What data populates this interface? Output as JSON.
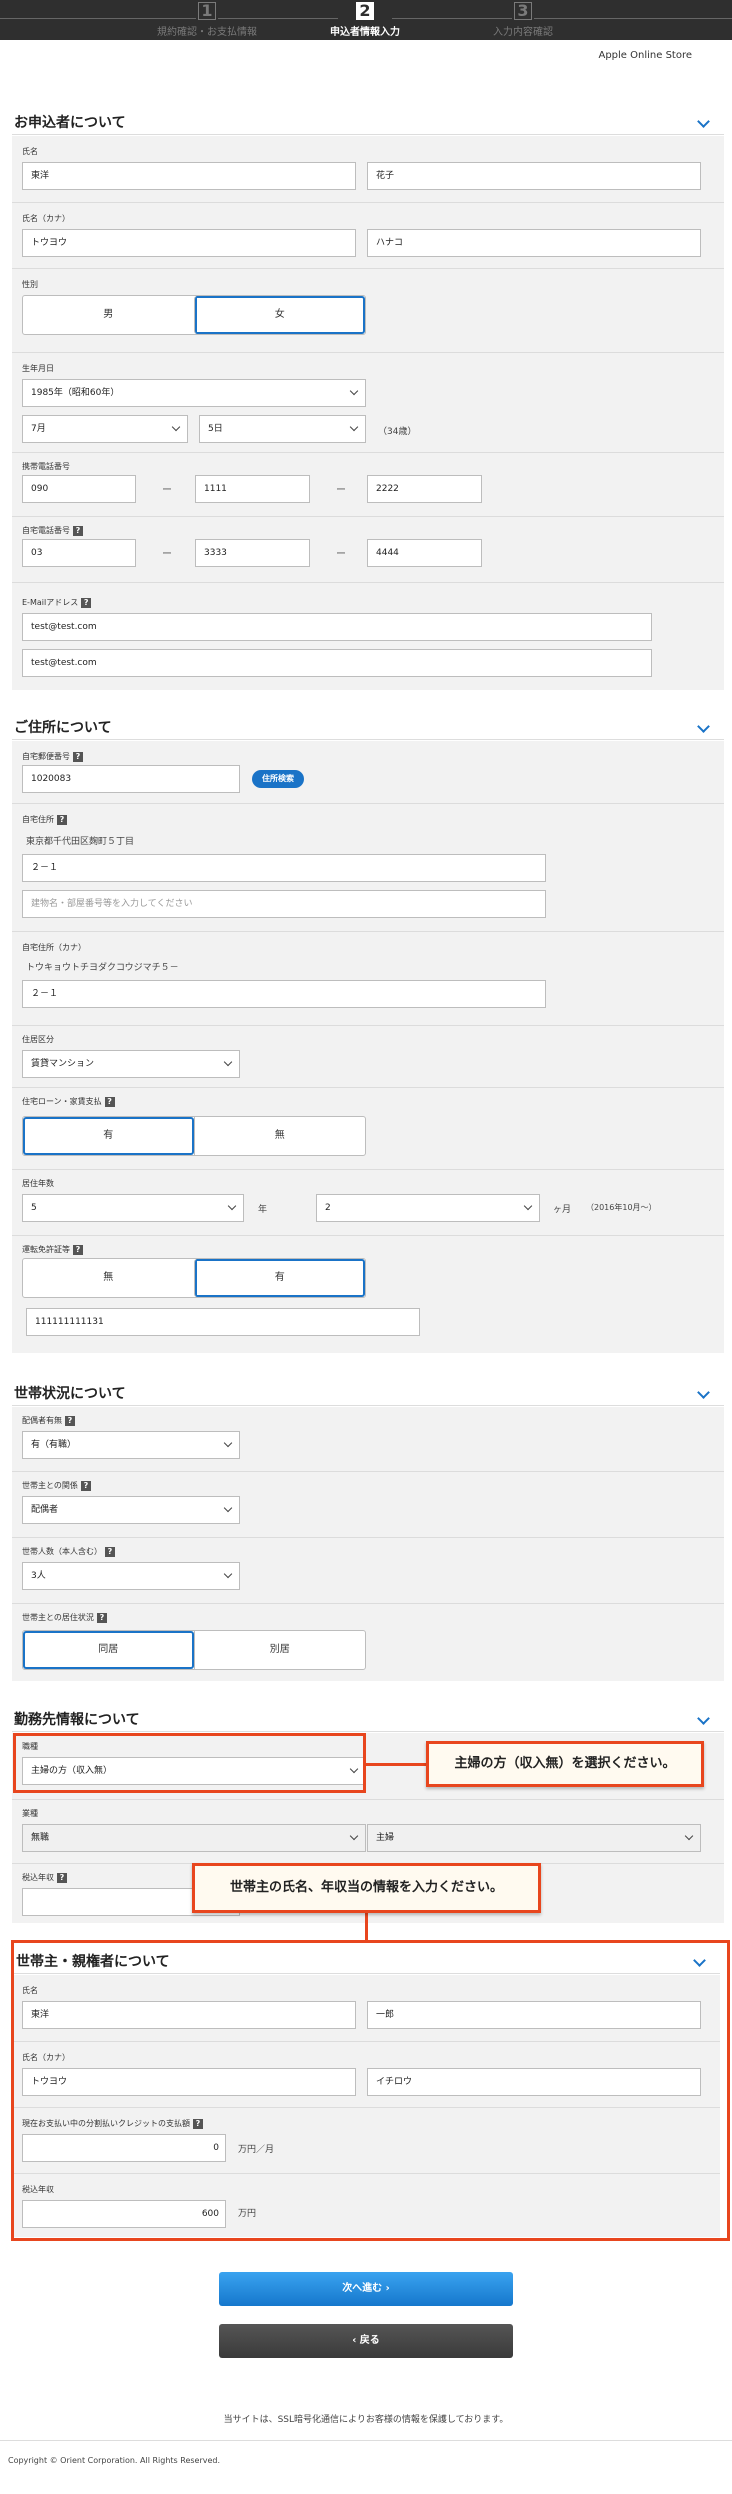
{
  "steps": [
    {
      "num": "1",
      "label": "規約確認・お支払情報"
    },
    {
      "num": "2",
      "label": "申込者情報入力"
    },
    {
      "num": "3",
      "label": "入力内容確認"
    }
  ],
  "store_name": "Apple Online Store",
  "applicant": {
    "title": "お申込者について",
    "name_label": "氏名",
    "last_name": "東洋",
    "first_name": "花子",
    "kana_label": "氏名（カナ）",
    "last_kana": "トウヨウ",
    "first_kana": "ハナコ",
    "gender_label": "性別",
    "gender_options": [
      "男",
      "女"
    ],
    "birth_label": "生年月日",
    "birth_year": "1985年（昭和60年）",
    "birth_month": "7月",
    "birth_day": "5日",
    "age_note": "（34歳）",
    "mobile_label": "携帯電話番号",
    "mobile": [
      "090",
      "1111",
      "2222"
    ],
    "home_phone_label": "自宅電話番号",
    "home_phone": [
      "03",
      "3333",
      "4444"
    ],
    "email_label": "E-Mailアドレス",
    "email": "test@test.com",
    "email_confirm": "test@test.com",
    "dash": "ー",
    "help": "?"
  },
  "address": {
    "title": "ご住所について",
    "zip_label": "自宅郵便番号",
    "zip": "1020083",
    "zip_search": "住所検索",
    "addr_label": "自宅住所",
    "addr_base": "東京都千代田区麹町５丁目",
    "addr_line": "２－１",
    "building_placeholder": "建物名・部屋番号等を入力してください",
    "kana_label": "自宅住所（カナ）",
    "kana_base": "トウキョウトチヨダクコウジマチ５－",
    "kana_line": "２－１",
    "type_label": "住居区分",
    "type_value": "賃貸マンション",
    "loan_label": "住宅ローン・家賃支払",
    "loan_options": [
      "有",
      "無"
    ],
    "years_label": "居住年数",
    "years_value": "5",
    "years_unit": "年",
    "months_value": "2",
    "months_unit": "ヶ月",
    "since_note": "（2016年10月～）",
    "license_label": "運転免許証等",
    "license_options": [
      "無",
      "有"
    ],
    "license_number": "111111111131"
  },
  "household": {
    "title": "世帯状況について",
    "spouse_label": "配偶者有無",
    "spouse_value": "有（有職）",
    "relation_label": "世帯主との関係",
    "relation_value": "配偶者",
    "members_label": "世帯人数（本人含む）",
    "members_value": "3人",
    "living_label": "世帯主との居住状況",
    "living_options": [
      "同居",
      "別居"
    ]
  },
  "employment": {
    "title": "勤務先情報について",
    "job_label": "職種",
    "job_value": "主婦の方（収入無）",
    "industry_label": "業種",
    "industry_value": "無職",
    "industry_sub": "主婦",
    "income_label": "税込年収",
    "callout1": "主婦の方（収入無）を選択ください。",
    "callout2": "世帯主の氏名、年収当の情報を入力ください。"
  },
  "householder": {
    "title": "世帯主・親権者について",
    "name_label": "氏名",
    "last_name": "東洋",
    "first_name": "一郎",
    "kana_label": "氏名（カナ）",
    "last_kana": "トウヨウ",
    "first_kana": "イチロウ",
    "credit_label": "現在お支払い中の分割払いクレジットの支払額",
    "credit_value": "0",
    "credit_unit": "万円／月",
    "income_label": "税込年収",
    "income_value": "600",
    "income_unit": "万円"
  },
  "buttons": {
    "next": "次へ進む ›",
    "back": "‹ 戻る"
  },
  "footer": {
    "ssl_note": "当サイトは、SSL暗号化通信によりお客様の情報を保護しております。",
    "copyright": "Copyright © Orient Corporation. All Rights Reserved."
  }
}
